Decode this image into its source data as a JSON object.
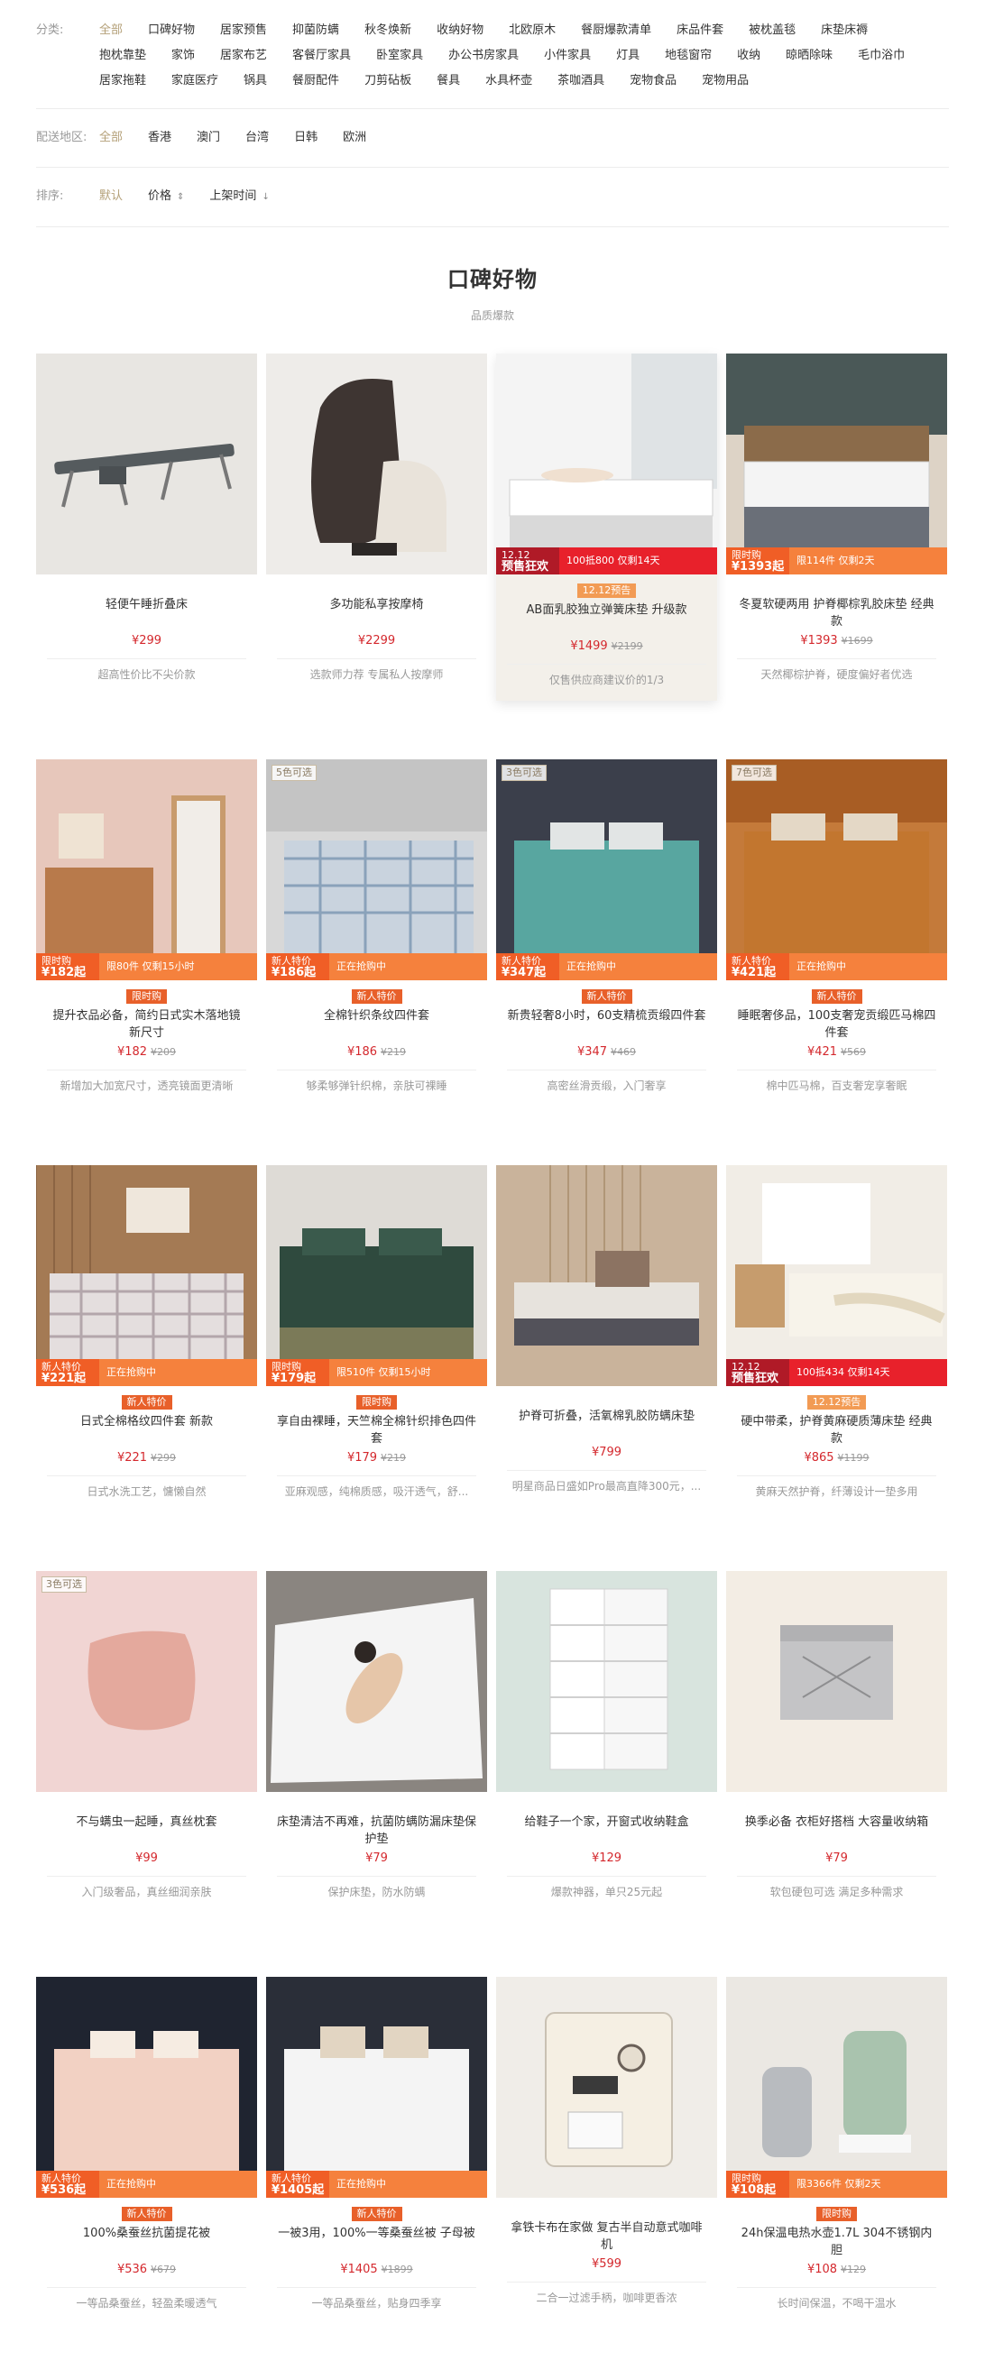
{
  "filters": {
    "category": {
      "label": "分类:",
      "items": [
        "全部",
        "口碑好物",
        "居家预售",
        "抑菌防螨",
        "秋冬焕新",
        "收纳好物",
        "北欧原木",
        "餐厨爆款清单",
        "床品件套",
        "被枕盖毯",
        "床垫床褥",
        "抱枕靠垫",
        "家饰",
        "居家布艺",
        "客餐厅家具",
        "卧室家具",
        "办公书房家具",
        "小件家具",
        "灯具",
        "地毯窗帘",
        "收纳",
        "晾晒除味",
        "毛巾浴巾",
        "居家拖鞋",
        "家庭医疗",
        "锅具",
        "餐厨配件",
        "刀剪砧板",
        "餐具",
        "水具杯壶",
        "茶咖酒具",
        "宠物食品",
        "宠物用品"
      ]
    },
    "region": {
      "label": "配送地区:",
      "items": [
        "全部",
        "香港",
        "澳门",
        "台湾",
        "日韩",
        "欧洲"
      ]
    },
    "sort": {
      "label": "排序:",
      "items": [
        "默认",
        "价格",
        "上架时间"
      ],
      "price_arrow": "▲▼",
      "time_arrow": "↓"
    }
  },
  "section": {
    "title": "口碑好物",
    "subtitle": "品质爆款"
  },
  "products": [
    {
      "name": "轻便午睡折叠床",
      "price": "¥299",
      "old": "",
      "desc": "超高性价比不尖价款",
      "badge": "",
      "promo": null,
      "tag": ""
    },
    {
      "name": "多功能私享按摩椅",
      "price": "¥2299",
      "old": "",
      "desc": "选款师力荐 专属私人按摩师",
      "badge": "",
      "promo": null,
      "tag": ""
    },
    {
      "name": "AB面乳胶独立弹簧床垫 升级款",
      "price": "¥1499",
      "old": "¥2199",
      "desc": "仅售供应商建议价的1/3",
      "badge": "12.12预告",
      "promo": {
        "type": "red",
        "a": "12.12",
        "b": "预售狂欢",
        "r": "100抵800 仅剩14天"
      },
      "tag": ""
    },
    {
      "name": "冬夏软硬两用 护脊椰棕乳胶床垫 经典款",
      "price": "¥1393",
      "old": "¥1699",
      "desc": "天然椰棕护脊，硬度偏好者优选",
      "badge": "",
      "promo": {
        "type": "orange",
        "a": "限时购",
        "b": "¥1393起",
        "r": "限114件 仅剩2天"
      },
      "tag": ""
    },
    {
      "name": "提升衣品必备，简约日式实木落地镜 新尺寸",
      "price": "¥182",
      "old": "¥209",
      "desc": "新增加大加宽尺寸，透亮镜面更清晰",
      "badge": "限时购",
      "promo": {
        "type": "orange",
        "a": "限时购",
        "b": "¥182起",
        "r": "限80件 仅剩15小时"
      },
      "tag": ""
    },
    {
      "name": "全棉针织条纹四件套",
      "price": "¥186",
      "old": "¥219",
      "desc": "够柔够弹针织棉，亲肤可裸睡",
      "badge": "新人特价",
      "promo": {
        "type": "orange",
        "a": "新人特价",
        "b": "¥186起",
        "r": "正在抢购中"
      },
      "tag": "5色可选"
    },
    {
      "name": "新贵轻奢8小时，60支精梳贡缎四件套",
      "price": "¥347",
      "old": "¥469",
      "desc": "高密丝滑贡缎，入门奢享",
      "badge": "新人特价",
      "promo": {
        "type": "orange",
        "a": "新人特价",
        "b": "¥347起",
        "r": "正在抢购中"
      },
      "tag": "3色可选"
    },
    {
      "name": "睡眠奢侈品，100支奢宠贡缎匹马棉四件套",
      "price": "¥421",
      "old": "¥569",
      "desc": "棉中匹马棉，百支奢宠享奢眠",
      "badge": "新人特价",
      "promo": {
        "type": "orange",
        "a": "新人特价",
        "b": "¥421起",
        "r": "正在抢购中"
      },
      "tag": "7色可选"
    },
    {
      "name": "日式全棉格纹四件套 新款",
      "price": "¥221",
      "old": "¥299",
      "desc": "日式水洗工艺，慵懒自然",
      "badge": "新人特价",
      "promo": {
        "type": "orange",
        "a": "新人特价",
        "b": "¥221起",
        "r": "正在抢购中"
      },
      "tag": ""
    },
    {
      "name": "享自由裸睡，天竺棉全棉针织排色四件套",
      "price": "¥179",
      "old": "¥219",
      "desc": "亚麻观感，纯棉质感，吸汗透气，舒...",
      "badge": "限时购",
      "promo": {
        "type": "orange",
        "a": "限时购",
        "b": "¥179起",
        "r": "限510件 仅剩15小时"
      },
      "tag": ""
    },
    {
      "name": "护脊可折叠，活氧棉乳胶防螨床垫",
      "price": "¥799",
      "old": "",
      "desc": "明星商品日盛如Pro最高直降300元，...",
      "badge": "",
      "promo": null,
      "tag": ""
    },
    {
      "name": "硬中带柔，护脊黄麻硬质薄床垫 经典款",
      "price": "¥865",
      "old": "¥1199",
      "desc": "黄麻天然护脊，纤薄设计一垫多用",
      "badge": "12.12预告",
      "promo": {
        "type": "red",
        "a": "12.12",
        "b": "预售狂欢",
        "r": "100抵434 仅剩14天"
      },
      "tag": ""
    },
    {
      "name": "不与螨虫一起睡，真丝枕套",
      "price": "¥99",
      "old": "",
      "desc": "入门级奢品，真丝细润亲肤",
      "badge": "",
      "promo": null,
      "tag": "3色可选"
    },
    {
      "name": "床垫清洁不再难，抗菌防螨防漏床垫保护垫",
      "price": "¥79",
      "old": "",
      "desc": "保护床垫，防水防螨",
      "badge": "",
      "promo": null,
      "tag": ""
    },
    {
      "name": "给鞋子一个家，开窗式收纳鞋盒",
      "price": "¥129",
      "old": "",
      "desc": "爆款神器，单只25元起",
      "badge": "",
      "promo": null,
      "tag": ""
    },
    {
      "name": "换季必备 衣柜好搭档 大容量收纳箱",
      "price": "¥79",
      "old": "",
      "desc": "软包硬包可选 满足多种需求",
      "badge": "",
      "promo": null,
      "tag": ""
    },
    {
      "name": "100%桑蚕丝抗菌提花被",
      "price": "¥536",
      "old": "¥679",
      "desc": "一等品桑蚕丝，轻盈柔暖透气",
      "badge": "新人特价",
      "promo": {
        "type": "orange",
        "a": "新人特价",
        "b": "¥536起",
        "r": "正在抢购中"
      },
      "tag": ""
    },
    {
      "name": "一被3用，100%一等桑蚕丝被 子母被",
      "price": "¥1405",
      "old": "¥1899",
      "desc": "一等品桑蚕丝，贴身四季享",
      "badge": "新人特价",
      "promo": {
        "type": "orange",
        "a": "新人特价",
        "b": "¥1405起",
        "r": "正在抢购中"
      },
      "tag": ""
    },
    {
      "name": "拿铁卡布在家做 复古半自动意式咖啡机",
      "price": "¥599",
      "old": "",
      "desc": "二合一过滤手柄，咖啡更香浓",
      "badge": "",
      "promo": null,
      "tag": ""
    },
    {
      "name": "24h保温电热水壶1.7L 304不锈钢内胆",
      "price": "¥108",
      "old": "¥129",
      "desc": "长时间保温，不喝干温水",
      "badge": "限时购",
      "promo": {
        "type": "orange",
        "a": "限时购",
        "b": "¥108起",
        "r": "限3366件 仅剩2天"
      },
      "tag": ""
    }
  ],
  "colors": {
    "accent": "#b4a078",
    "price": "#d4282d",
    "promo_orange": "#f05e26",
    "promo_red": "#e8212b"
  }
}
